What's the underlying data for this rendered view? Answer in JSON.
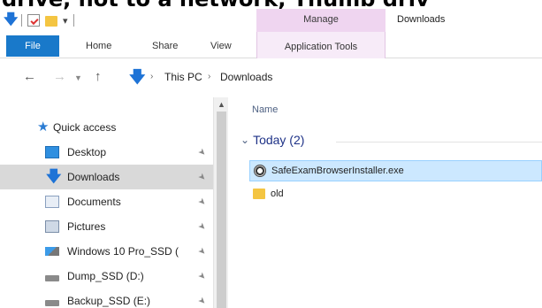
{
  "caption": "drive, not to a network, Thumb driv",
  "title_bar": {
    "context_tab": "Manage",
    "window_title": "Downloads"
  },
  "ribbon": {
    "tabs": [
      {
        "label": "File"
      },
      {
        "label": "Home"
      },
      {
        "label": "Share"
      },
      {
        "label": "View"
      }
    ],
    "context_group": "Application Tools"
  },
  "address_bar": {
    "path": [
      "This PC",
      "Downloads"
    ],
    "separator": "›"
  },
  "nav_pane": {
    "items": [
      {
        "label": "Quick access",
        "icon": "star-icon",
        "pinned": false,
        "selected": false
      },
      {
        "label": "Desktop",
        "icon": "desktop-icon",
        "pinned": true,
        "selected": false
      },
      {
        "label": "Downloads",
        "icon": "downloads-icon",
        "pinned": true,
        "selected": true
      },
      {
        "label": "Documents",
        "icon": "documents-icon",
        "pinned": true,
        "selected": false
      },
      {
        "label": "Pictures",
        "icon": "pictures-icon",
        "pinned": true,
        "selected": false
      },
      {
        "label": "Windows 10 Pro_SSD (",
        "icon": "windows-drive-icon",
        "pinned": true,
        "selected": false
      },
      {
        "label": "Dump_SSD (D:)",
        "icon": "drive-icon",
        "pinned": true,
        "selected": false
      },
      {
        "label": "Backup_SSD (E:)",
        "icon": "drive-icon",
        "pinned": true,
        "selected": false
      }
    ]
  },
  "content": {
    "column_header": "Name",
    "group": {
      "label": "Today (2)",
      "chevron": "⌄"
    },
    "files": [
      {
        "name": "SafeExamBrowserInstaller.exe",
        "icon": "exe-icon",
        "selected": true
      },
      {
        "name": "old",
        "icon": "folder-icon",
        "selected": false
      }
    ]
  },
  "colors": {
    "file_tab": "#1979ca",
    "manage_tab": "#efd5f0",
    "selection": "#cce8ff",
    "group_text": "#1e3287"
  }
}
